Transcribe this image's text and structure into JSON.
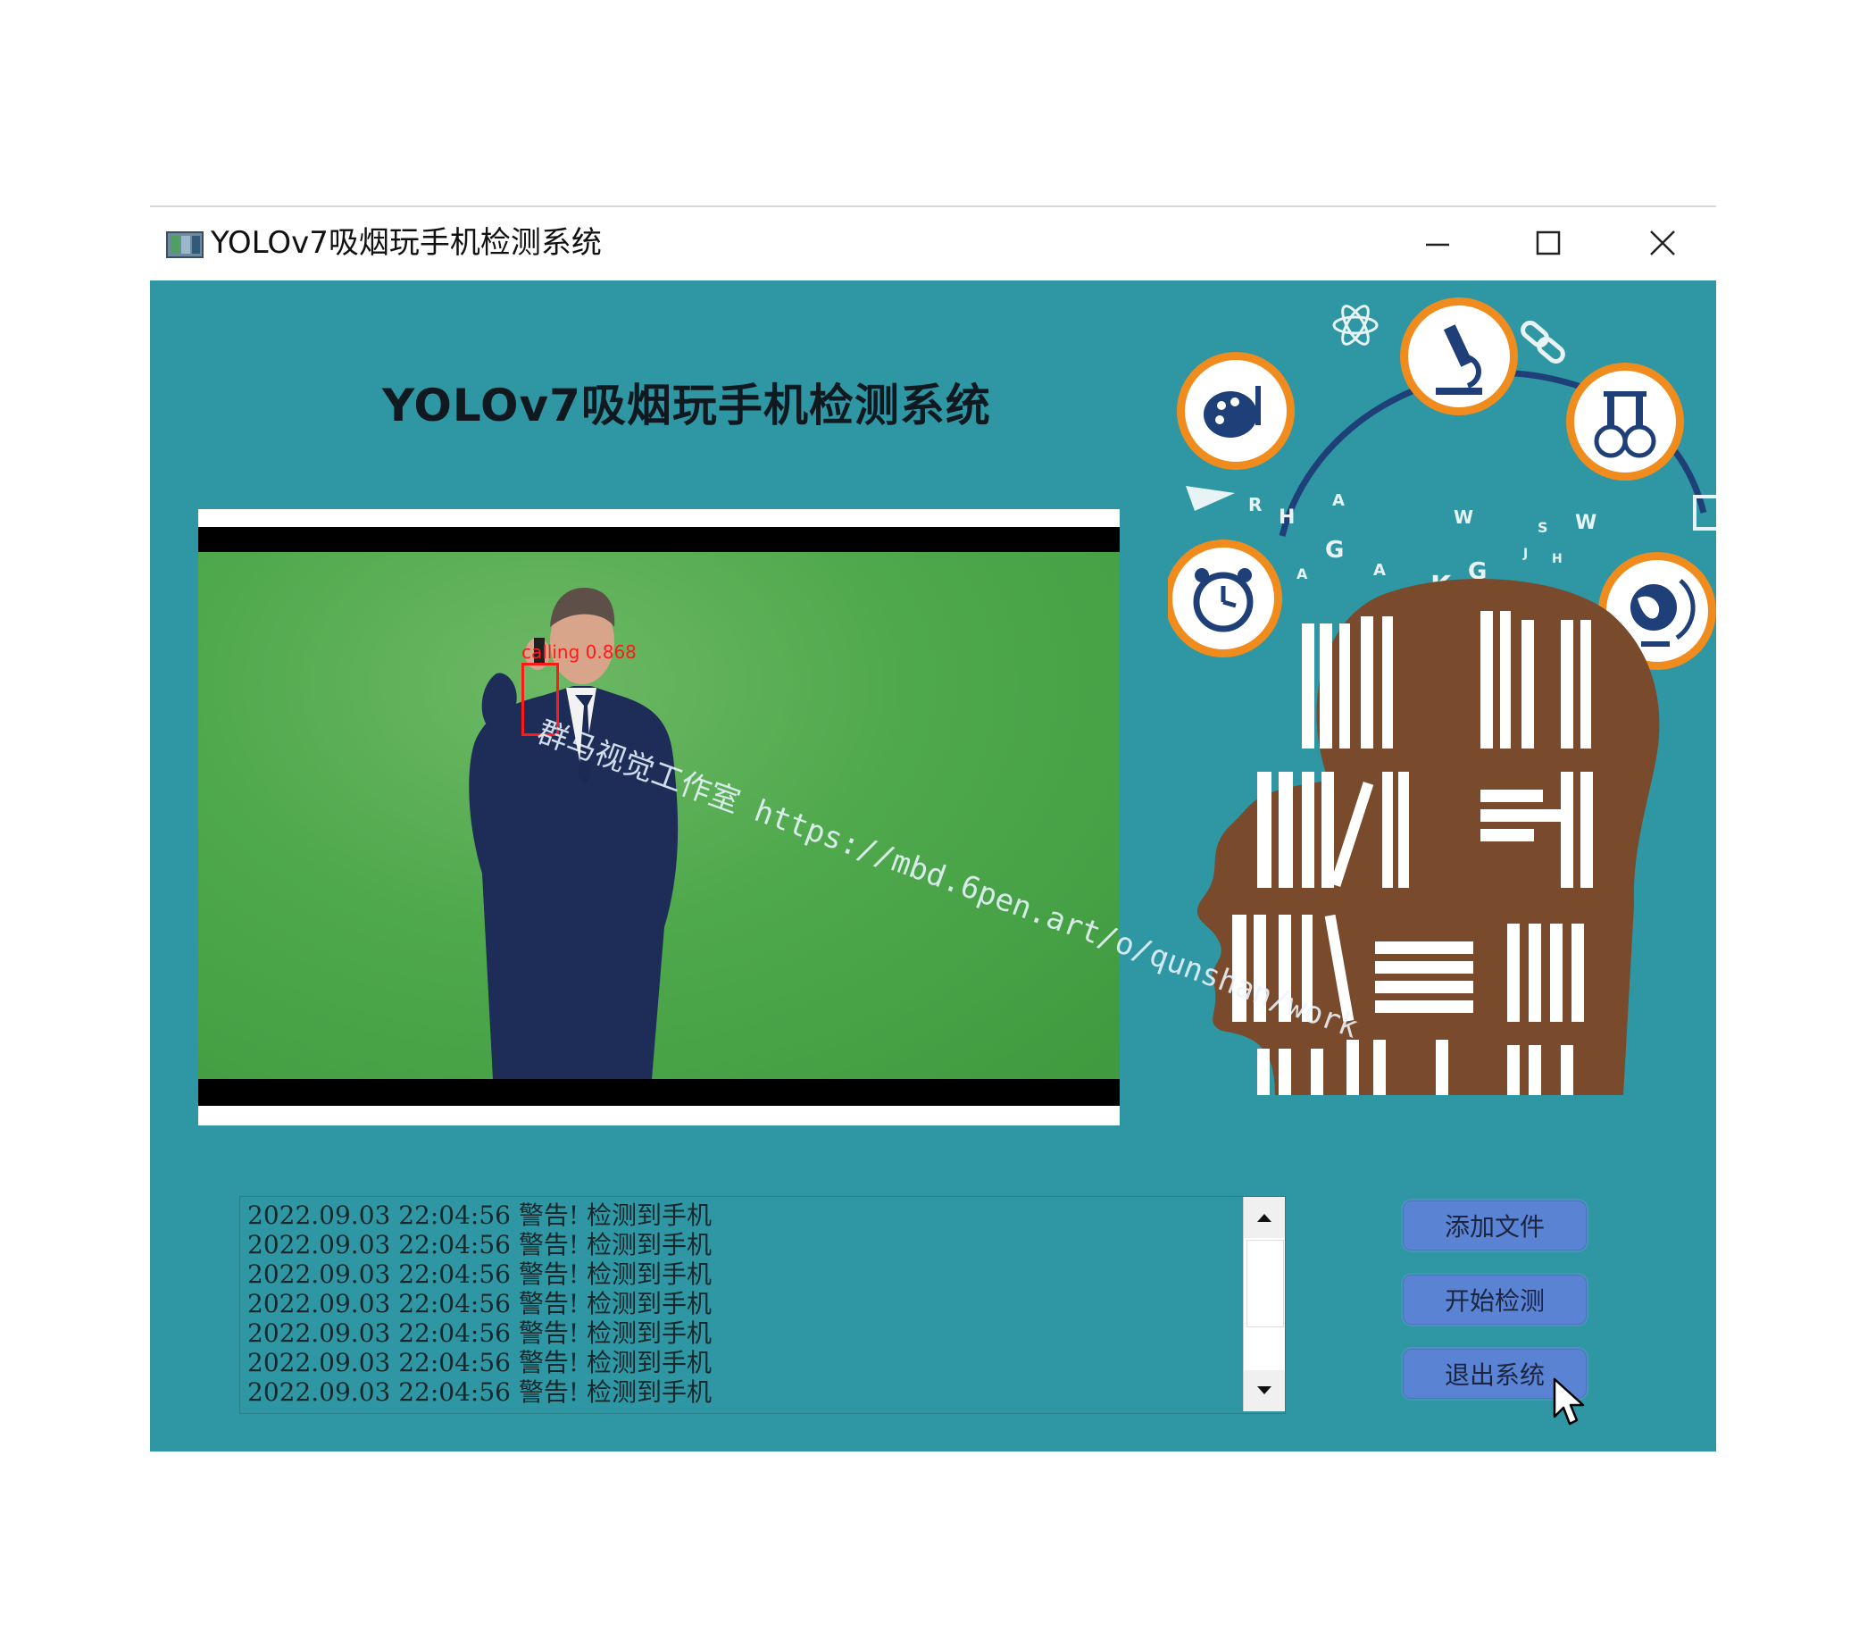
{
  "window": {
    "title": "YOLOv7吸烟玩手机检测系统"
  },
  "main": {
    "heading": "YOLOv7吸烟玩手机检测系统"
  },
  "video": {
    "detection_label": "calling 0.868",
    "watermark": "群马视觉工作室 https://mbd.6pen.art/o/qunshan/work"
  },
  "log": {
    "lines": [
      "2022.09.03 22:04:56 警告! 检测到手机",
      "2022.09.03 22:04:56 警告! 检测到手机",
      "2022.09.03 22:04:56 警告! 检测到手机",
      "2022.09.03 22:04:56 警告! 检测到手机",
      "2022.09.03 22:04:56 警告! 检测到手机",
      "2022.09.03 22:04:56 警告! 检测到手机",
      "2022.09.03 22:04:56 警告! 检测到手机"
    ]
  },
  "buttons": {
    "add_file": "添加文件",
    "start_detect": "开始检测",
    "exit_system": "退出系统"
  },
  "decoration": {
    "letters": [
      "R",
      "H",
      "A",
      "G",
      "A",
      "W",
      "A",
      "G",
      "K",
      "S",
      "W",
      "J",
      "H"
    ]
  },
  "colors": {
    "background": "#2e97a3",
    "button": "#5b83d4",
    "detection_box": "#ff1a1a",
    "circle_ring": "#f08c1e"
  }
}
